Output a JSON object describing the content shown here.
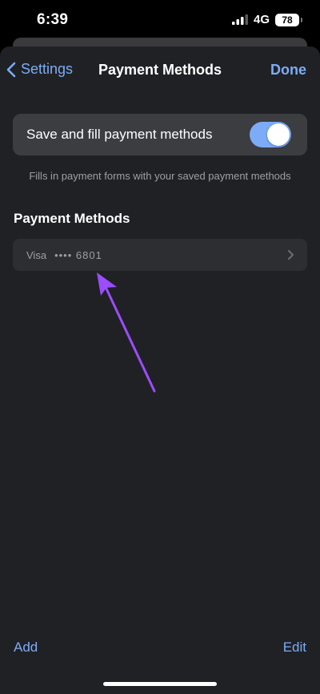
{
  "status_bar": {
    "time": "6:39",
    "network": "4G",
    "battery": "78"
  },
  "nav": {
    "back_label": "Settings",
    "title": "Payment Methods",
    "done_label": "Done"
  },
  "toggle": {
    "label": "Save and fill payment methods",
    "caption": "Fills in payment forms with your saved payment methods",
    "enabled": true
  },
  "section": {
    "title": "Payment Methods"
  },
  "payment_methods": [
    {
      "brand": "Visa",
      "masked_number": "•••• 6801"
    }
  ],
  "toolbar": {
    "add_label": "Add",
    "edit_label": "Edit"
  },
  "colors": {
    "accent": "#7cacf8",
    "annotation": "#9b4dff",
    "sheet_background": "#202124"
  }
}
